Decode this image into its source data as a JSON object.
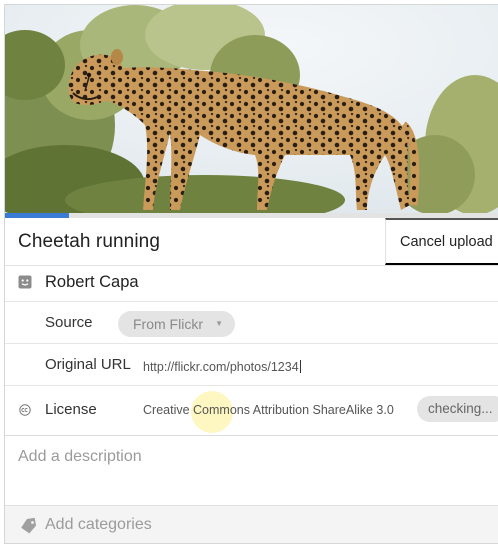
{
  "photo": {
    "subject_icon": "cheetah-photo"
  },
  "upload": {
    "progress": 0.13,
    "progress_color": "#3a7bd5"
  },
  "title": {
    "value": "Cheetah running"
  },
  "actions": {
    "cancel_label": "Cancel upload"
  },
  "author": {
    "icon": "user-icon",
    "name": "Robert Capa"
  },
  "source": {
    "label": "Source",
    "selected": "From Flickr",
    "caret": "▼"
  },
  "original_url": {
    "label": "Original URL",
    "value": "http://flickr.com/photos/1234"
  },
  "license": {
    "icon": "creative-commons-icon",
    "label": "License",
    "value": "Creative Commons Attribution ShareAlike 3.0",
    "status_label": "checking..."
  },
  "description": {
    "placeholder": "Add a description"
  },
  "categories": {
    "icon": "tag-icon",
    "label": "Add categories"
  }
}
